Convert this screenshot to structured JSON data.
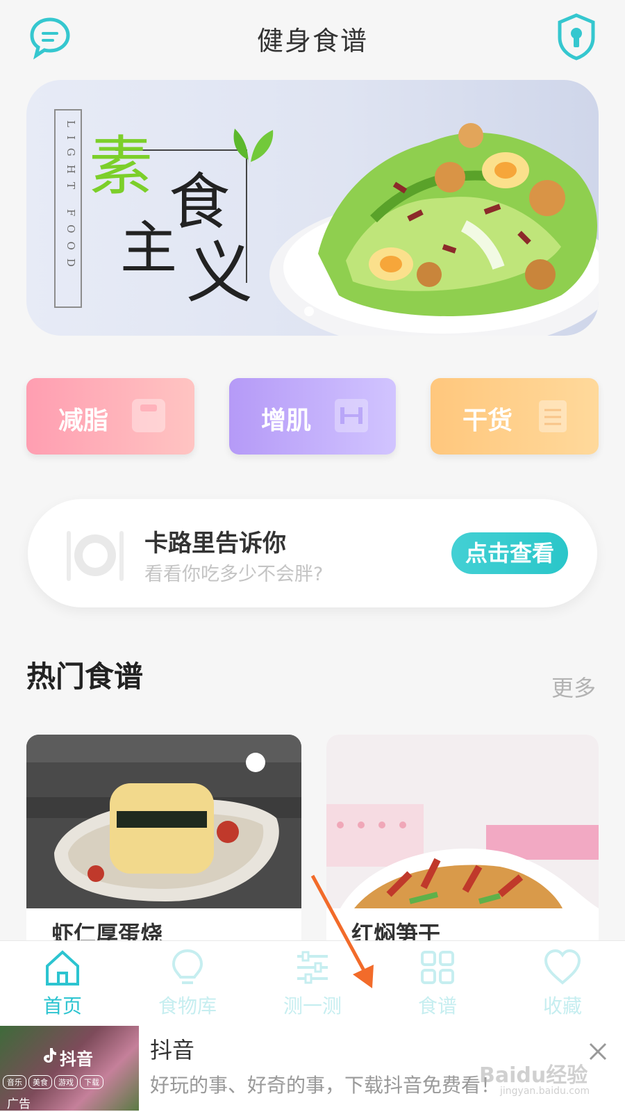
{
  "header": {
    "title": "健身食谱"
  },
  "banner": {
    "side_text": "LIGHT FOOD",
    "art_chars": [
      "素",
      "主",
      "食",
      "义"
    ]
  },
  "categories": [
    {
      "label": "减脂",
      "icon": "scale-icon"
    },
    {
      "label": "增肌",
      "icon": "dumbbell-icon"
    },
    {
      "label": "干货",
      "icon": "clipboard-icon"
    }
  ],
  "calorie_card": {
    "title": "卡路里告诉你",
    "subtitle": "看看你吃多少不会胖?",
    "button_label": "点击查看"
  },
  "hot_section": {
    "title": "热门食谱",
    "more_label": "更多"
  },
  "recipes": [
    {
      "name": "虾仁厚蛋烧"
    },
    {
      "name": "红焖笋干"
    }
  ],
  "tabbar": {
    "items": [
      {
        "label": "首页",
        "icon": "home-icon",
        "active": true
      },
      {
        "label": "食物库",
        "icon": "lightbulb-icon",
        "active": false
      },
      {
        "label": "测一测",
        "icon": "sliders-icon",
        "active": false
      },
      {
        "label": "食谱",
        "icon": "grid-icon",
        "active": false
      },
      {
        "label": "收藏",
        "icon": "heart-icon",
        "active": false
      }
    ]
  },
  "ad": {
    "image_brand": "抖音",
    "image_pills": [
      "音乐",
      "美食",
      "游戏",
      "下载"
    ],
    "ad_tag": "广告",
    "title": "抖音",
    "description": "好玩的事、好奇的事，下载抖音免费看！"
  },
  "watermark": {
    "main": "Baidu经验",
    "sub": "jingyan.baidu.com"
  },
  "colors": {
    "accent": "#2cc4d0",
    "inactive_tab": "#c6eef0",
    "fat_loss": "#ff9eb1",
    "muscle": "#b59af7",
    "dry_goods": "#ffc77d",
    "arrow": "#f26b2a"
  }
}
